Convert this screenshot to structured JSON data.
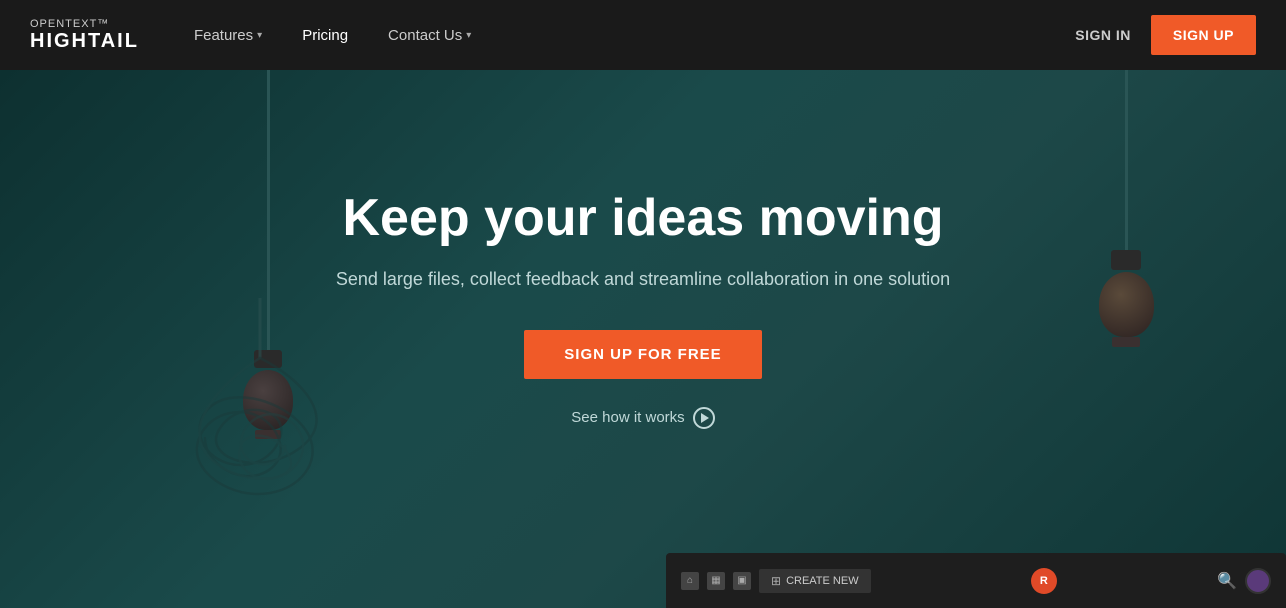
{
  "navbar": {
    "logo": {
      "opentext_label": "opentext™",
      "hightail_label": "HIGHTAIL"
    },
    "nav_items": [
      {
        "label": "Features",
        "has_dropdown": true
      },
      {
        "label": "Pricing",
        "has_dropdown": false
      },
      {
        "label": "Contact Us",
        "has_dropdown": true
      }
    ],
    "sign_in_label": "SIGN IN",
    "sign_up_label": "SIGN UP"
  },
  "hero": {
    "title": "Keep your ideas moving",
    "subtitle": "Send large files, collect feedback and streamline collaboration in one solution",
    "cta_button": "SIGN UP FOR FREE",
    "see_how_label": "See how it works"
  },
  "app_preview": {
    "create_new_label": "CREATE NEW",
    "avatar_initial": "R"
  },
  "colors": {
    "accent_orange": "#f05a28",
    "navbar_bg": "#1a1a1a",
    "hero_bg": "#1a3a3a"
  }
}
